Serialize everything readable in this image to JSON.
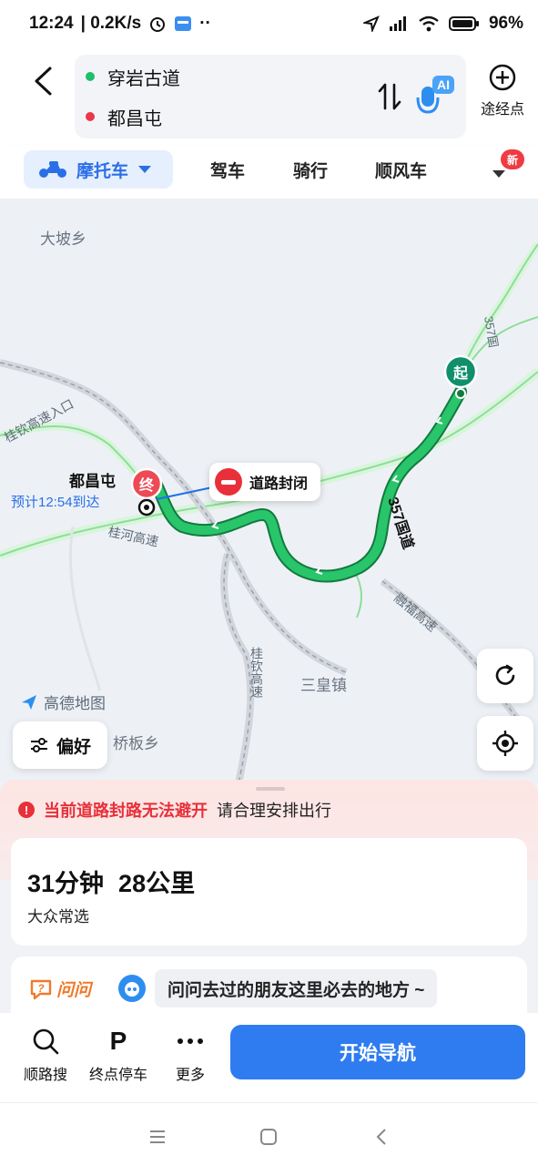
{
  "status_bar": {
    "time": "12:24",
    "net_speed": "| 0.2K/s",
    "battery": "96%"
  },
  "route": {
    "start": "穿岩古道",
    "end": "都昌屯",
    "waypoint_label": "途经点",
    "ai_label": "AI"
  },
  "modes": {
    "active": "摩托车",
    "tabs": [
      "驾车",
      "骑行",
      "顺风车"
    ],
    "new_badge": "新"
  },
  "map": {
    "places": {
      "dapo": "大坡乡",
      "qiaoban": "桥板乡",
      "sanhuang": "三皇镇"
    },
    "roads": {
      "guihe": "桂河高速",
      "guiqin_entrance": "桂钦高速入口",
      "guiqin_vertical": "桂钦高速",
      "rongfu": "融福高速",
      "g357": "357国道",
      "g357_top": "357国"
    },
    "end_name": "都昌屯",
    "eta": "预计12:54到达",
    "start_marker": "起",
    "end_marker": "终",
    "road_closed": "道路封闭",
    "logo": "高德地图",
    "preference": "偏好"
  },
  "sheet": {
    "alert_strong": "当前道路封路无法避开",
    "alert_sub": "请合理安排出行",
    "duration": "31分钟",
    "distance": "28公里",
    "route_tag": "大众常选",
    "ask_logo": "问问",
    "ask_text": "问问去过的朋友这里必去的地方 ~"
  },
  "bottom_bar": {
    "search_along": "顺路搜",
    "parking": "终点停车",
    "more": "更多",
    "start_nav": "开始导航"
  },
  "colors": {
    "route_green": "#1db35c",
    "accent_blue": "#2f7cf0",
    "alert_red": "#e8303a"
  }
}
